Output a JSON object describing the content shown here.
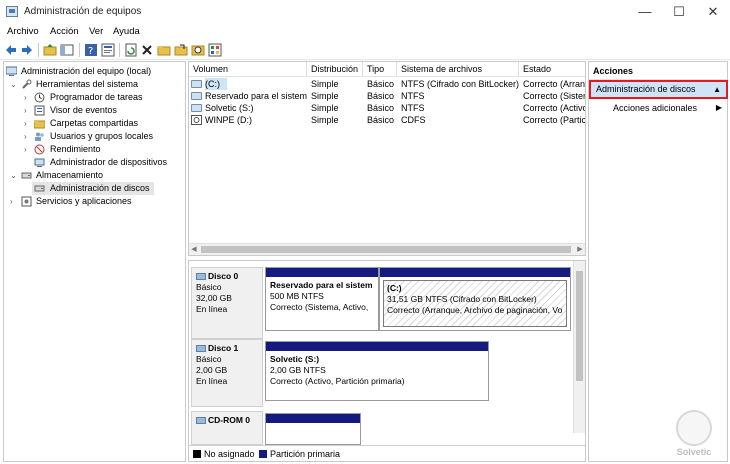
{
  "window": {
    "title": "Administración de equipos",
    "controls": {
      "minimize": "—",
      "maximize": "☐",
      "close": "✕"
    }
  },
  "menu": [
    "Archivo",
    "Acción",
    "Ver",
    "Ayuda"
  ],
  "tree": {
    "root": "Administración del equipo (local)",
    "items": [
      {
        "label": "Herramientas del sistema",
        "icon": "tools-icon"
      },
      {
        "label": "Programador de tareas",
        "icon": "clock-icon"
      },
      {
        "label": "Visor de eventos",
        "icon": "event-viewer-icon"
      },
      {
        "label": "Carpetas compartidas",
        "icon": "shared-folder-icon"
      },
      {
        "label": "Usuarios y grupos locales",
        "icon": "users-icon"
      },
      {
        "label": "Rendimiento",
        "icon": "performance-icon"
      },
      {
        "label": "Administrador de dispositivos",
        "icon": "device-manager-icon"
      },
      {
        "label": "Almacenamiento",
        "icon": "storage-icon"
      },
      {
        "label": "Administración de discos",
        "icon": "disk-icon"
      },
      {
        "label": "Servicios y aplicaciones",
        "icon": "services-icon"
      }
    ]
  },
  "volumes": {
    "headers": [
      "Volumen",
      "Distribución",
      "Tipo",
      "Sistema de archivos",
      "Estado"
    ],
    "rows": [
      [
        "(C:)",
        "Simple",
        "Básico",
        "NTFS (Cifrado con BitLocker)",
        "Correcto (Arranq"
      ],
      [
        "Reservado para el sistema",
        "Simple",
        "Básico",
        "NTFS",
        "Correcto (Sisten"
      ],
      [
        "Solvetic (S:)",
        "Simple",
        "Básico",
        "NTFS",
        "Correcto (Activo"
      ],
      [
        "WINPE (D:)",
        "Simple",
        "Básico",
        "CDFS",
        "Correcto (Partic"
      ]
    ]
  },
  "disks": [
    {
      "name": "Disco 0",
      "type": "Básico",
      "size": "32,00 GB",
      "status": "En línea",
      "partitions": [
        {
          "name": "Reservado para el sistem",
          "size": "500 MB NTFS",
          "status": "Correcto (Sistema, Activo,"
        },
        {
          "name": "(C:)",
          "size": "31,51 GB NTFS (Cifrado con BitLocker)",
          "status": "Correcto (Arranque, Archivo de paginación, Vo"
        }
      ]
    },
    {
      "name": "Disco 1",
      "type": "Básico",
      "size": "2,00 GB",
      "status": "En línea",
      "partitions": [
        {
          "name": "Solvetic  (S:)",
          "size": "2,00 GB NTFS",
          "status": "Correcto (Activo, Partición primaria)"
        }
      ]
    },
    {
      "name": "CD-ROM 0"
    }
  ],
  "legend": [
    {
      "label": "No asignado",
      "color": "#000000"
    },
    {
      "label": "Partición primaria",
      "color": "#141a80"
    }
  ],
  "actions": {
    "header": "Acciones",
    "selected": "Administración de discos",
    "items": [
      "Acciones adicionales"
    ]
  },
  "watermark": {
    "text": "Solvetic"
  }
}
